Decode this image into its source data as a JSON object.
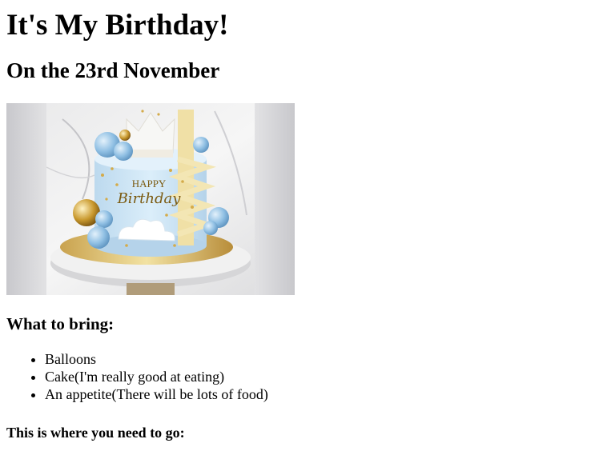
{
  "header": {
    "title": "It's My Birthday!",
    "subtitle": "On the 23rd November"
  },
  "cake_image": {
    "topper_line1": "HAPPY",
    "topper_line2": "Birthday"
  },
  "bring": {
    "heading": "What to bring:",
    "items": [
      "Balloons",
      "Cake(I'm really good at eating)",
      "An appetite(There will be lots of food)"
    ]
  },
  "directions": {
    "heading": "This is where you need to go:"
  }
}
